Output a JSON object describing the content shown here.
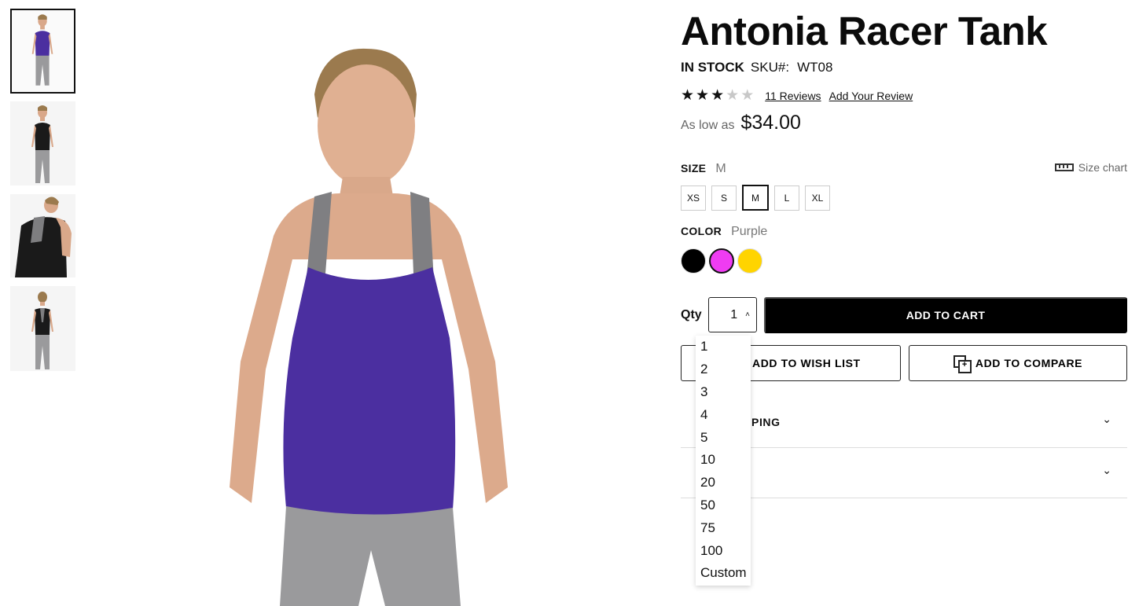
{
  "product": {
    "title": "Antonia Racer Tank",
    "stock": "IN STOCK",
    "sku_label": "SKU#:",
    "sku": "WT08",
    "rating": 3,
    "rating_max": 5,
    "reviews_link": "11  Reviews",
    "add_review": "Add Your Review",
    "price_label": "As low as",
    "price": "$34.00"
  },
  "icons": {
    "star_filled": "star-filled-icon",
    "star_empty": "star-empty-icon",
    "ruler": "ruler-icon",
    "compare": "compare-icon",
    "chevron": "chevron-down-icon"
  },
  "size": {
    "label": "SIZE",
    "selected": "M",
    "chart_link": "Size chart",
    "options": [
      "XS",
      "S",
      "M",
      "L",
      "XL"
    ]
  },
  "color": {
    "label": "COLOR",
    "selected": "Purple",
    "options": [
      {
        "name": "Black",
        "hex": "#000000"
      },
      {
        "name": "Purple",
        "hex": "#ef3cf2"
      },
      {
        "name": "Yellow",
        "hex": "#ffd400"
      }
    ]
  },
  "qty": {
    "label": "Qty",
    "value": "1",
    "caret": "˄",
    "options": [
      "1",
      "2",
      "3",
      "4",
      "5",
      "10",
      "20",
      "50",
      "75",
      "100",
      "Custom"
    ]
  },
  "actions": {
    "add_to_cart": "ADD TO CART",
    "wish_list": "ADD TO WISH LIST",
    "compare": "ADD TO COMPARE"
  },
  "accordions": [
    {
      "title": "PING"
    },
    {
      "title": ""
    }
  ],
  "colors": {
    "accent": "#000000",
    "tank_purple": "#4b2fa0",
    "leggings_gray": "#9a9a9c",
    "page_bg": "#ffffff"
  }
}
